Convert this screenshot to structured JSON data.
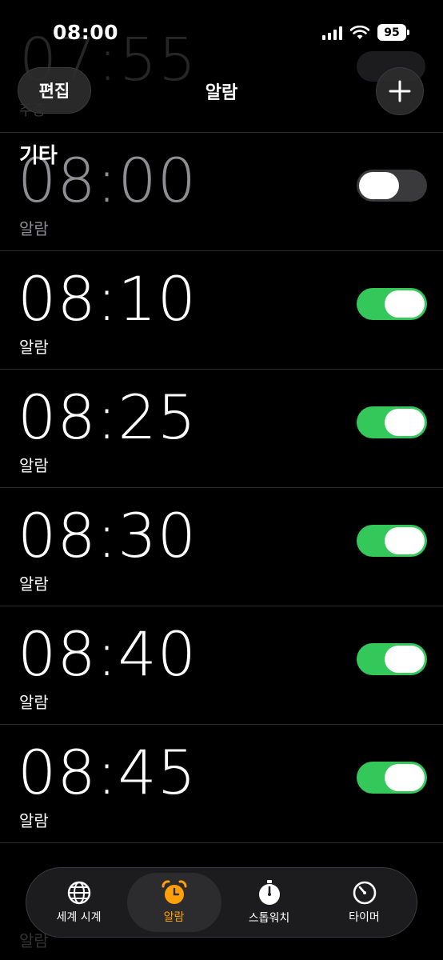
{
  "status": {
    "time": "08:00",
    "battery": "95"
  },
  "ghost": {
    "top_time": "07:55",
    "top_sub": "주중",
    "bottom_label": "알람"
  },
  "nav": {
    "edit_label": "편집",
    "title": "알람"
  },
  "section_header": "기타",
  "alarms": [
    {
      "time": "08:00",
      "label": "알람",
      "enabled": false
    },
    {
      "time": "08:10",
      "label": "알람",
      "enabled": true
    },
    {
      "time": "08:25",
      "label": "알람",
      "enabled": true
    },
    {
      "time": "08:30",
      "label": "알람",
      "enabled": true
    },
    {
      "time": "08:40",
      "label": "알람",
      "enabled": true
    },
    {
      "time": "08:45",
      "label": "알람",
      "enabled": true
    }
  ],
  "tabs": [
    {
      "label": "세계 시계",
      "icon": "globe-icon",
      "active": false
    },
    {
      "label": "알람",
      "icon": "alarm-clock-icon",
      "active": true
    },
    {
      "label": "스톱워치",
      "icon": "stopwatch-icon",
      "active": false
    },
    {
      "label": "타이머",
      "icon": "timer-icon",
      "active": false
    }
  ],
  "colors": {
    "accent": "#ff9f0a",
    "toggle_on": "#34c759",
    "background": "#000000"
  }
}
